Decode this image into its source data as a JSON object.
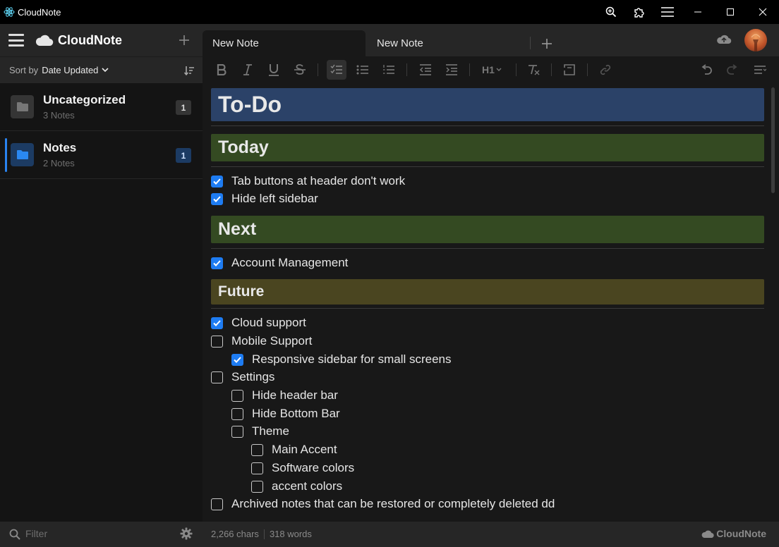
{
  "window": {
    "title": "CloudNote",
    "icons": [
      "react-icon",
      "zoom-in-icon",
      "extensions-icon",
      "menu-icon",
      "minimize-icon",
      "maximize-icon",
      "close-icon"
    ]
  },
  "sidebar": {
    "brand": "CloudNote",
    "sort_by_label": "Sort by",
    "sort_value": "Date Updated",
    "folders": [
      {
        "name": "Uncategorized",
        "count_label": "3 Notes",
        "badge": "1",
        "active": false
      },
      {
        "name": "Notes",
        "count_label": "2 Notes",
        "badge": "1",
        "active": true
      }
    ]
  },
  "tabs": [
    {
      "label": "New Note",
      "active": true
    },
    {
      "label": "New Note",
      "active": false
    }
  ],
  "toolbar": {
    "heading_label": "H1",
    "tools": [
      "bold-icon",
      "italic-icon",
      "underline-icon",
      "strikethrough-icon",
      "checklist-icon",
      "bullet-list-icon",
      "numbered-list-icon",
      "outdent-icon",
      "indent-icon",
      "heading-icon",
      "clear-format-icon",
      "frame-icon",
      "link-icon",
      "undo-icon",
      "redo-icon",
      "more-icon"
    ]
  },
  "editor": {
    "title": "To-Do",
    "sections": {
      "today": "Today",
      "next": "Next",
      "future": "Future"
    },
    "items": [
      {
        "text": "Tab buttons at header don't work",
        "checked": true,
        "level": 0
      },
      {
        "text": "Hide left sidebar",
        "checked": true,
        "level": 0
      },
      {
        "text": "Account Management",
        "checked": true,
        "level": 0
      },
      {
        "text": "Cloud support",
        "checked": true,
        "level": 0
      },
      {
        "text": "Mobile Support",
        "checked": false,
        "level": 0
      },
      {
        "text": "Responsive sidebar for small screens",
        "checked": true,
        "level": 1
      },
      {
        "text": "Settings",
        "checked": false,
        "level": 0
      },
      {
        "text": "Hide header bar",
        "checked": false,
        "level": 1
      },
      {
        "text": "Hide Bottom Bar",
        "checked": false,
        "level": 1
      },
      {
        "text": "Theme",
        "checked": false,
        "level": 1
      },
      {
        "text": "Main Accent",
        "checked": false,
        "level": 2
      },
      {
        "text": "Software colors",
        "checked": false,
        "level": 2
      },
      {
        "text": "accent colors",
        "checked": false,
        "level": 2
      },
      {
        "text": "Archived notes that can be restored or completely deleted dd",
        "checked": false,
        "level": 0
      }
    ]
  },
  "bottom": {
    "filter_placeholder": "Filter",
    "chars": "2,266 chars",
    "words": "318 words",
    "brand": "CloudNote"
  },
  "colors": {
    "accent": "#1e7cf2",
    "title_block": "#2b4268",
    "section_green": "#344a22",
    "section_olive": "#4a4520"
  }
}
